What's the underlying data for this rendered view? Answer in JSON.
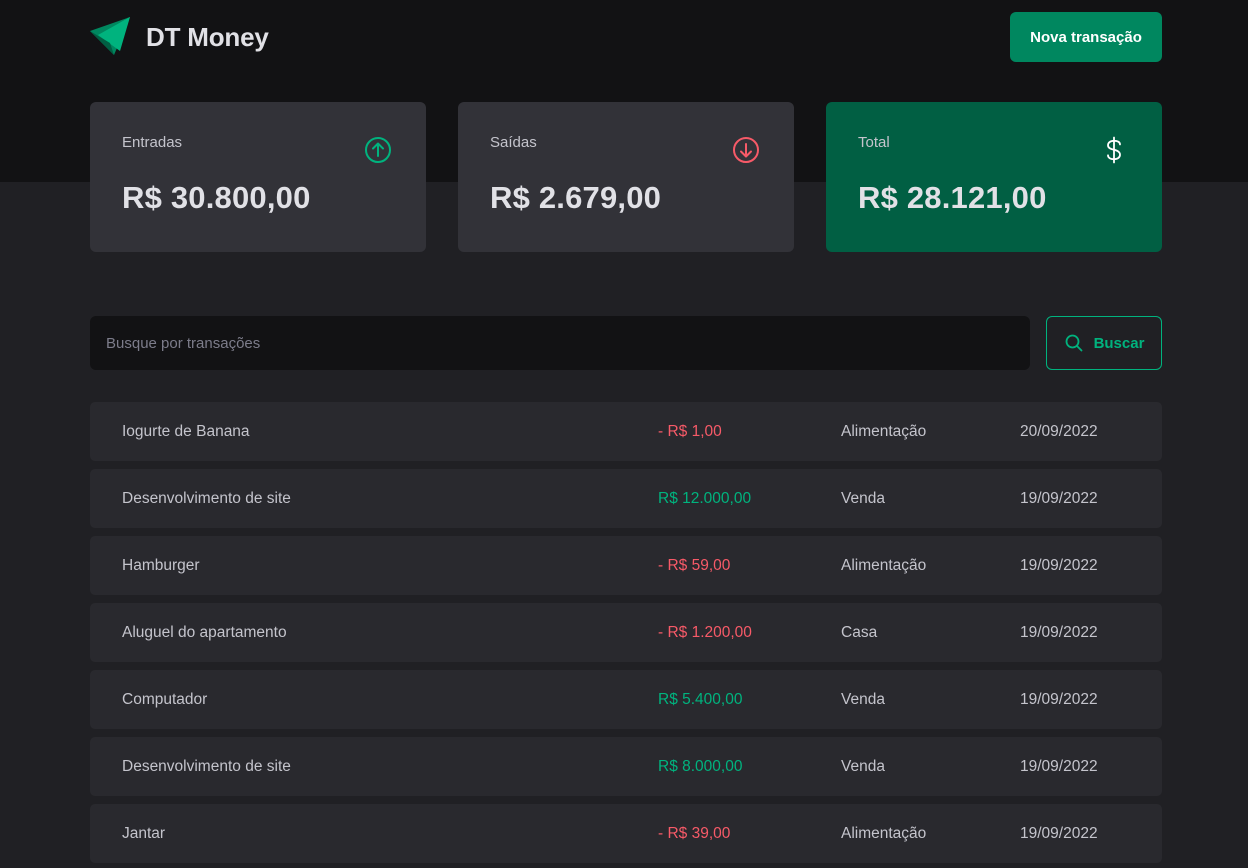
{
  "header": {
    "brand_name": "DT Money",
    "new_transaction_label": "Nova transação"
  },
  "summary": {
    "income": {
      "label": "Entradas",
      "value": "R$ 30.800,00",
      "icon": "arrow-circle-up-icon"
    },
    "outcome": {
      "label": "Saídas",
      "value": "R$ 2.679,00",
      "icon": "arrow-circle-down-icon"
    },
    "total": {
      "label": "Total",
      "value": "R$ 28.121,00",
      "icon": "currency-dollar-icon"
    }
  },
  "search": {
    "placeholder": "Busque por transações",
    "button_label": "Buscar"
  },
  "transactions": [
    {
      "description": "Iogurte de Banana",
      "price": "- R$ 1,00",
      "type": "outcome",
      "category": "Alimentação",
      "date": "20/09/2022"
    },
    {
      "description": "Desenvolvimento de site",
      "price": "R$ 12.000,00",
      "type": "income",
      "category": "Venda",
      "date": "19/09/2022"
    },
    {
      "description": "Hamburger",
      "price": "- R$ 59,00",
      "type": "outcome",
      "category": "Alimentação",
      "date": "19/09/2022"
    },
    {
      "description": "Aluguel do apartamento",
      "price": "- R$ 1.200,00",
      "type": "outcome",
      "category": "Casa",
      "date": "19/09/2022"
    },
    {
      "description": "Computador",
      "price": "R$ 5.400,00",
      "type": "income",
      "category": "Venda",
      "date": "19/09/2022"
    },
    {
      "description": "Desenvolvimento de site",
      "price": "R$ 8.000,00",
      "type": "income",
      "category": "Venda",
      "date": "19/09/2022"
    },
    {
      "description": "Jantar",
      "price": "- R$ 39,00",
      "type": "outcome",
      "category": "Alimentação",
      "date": "19/09/2022"
    }
  ],
  "colors": {
    "background": "#202024",
    "header_background": "#121214",
    "card": "#323238",
    "card_total": "#015f43",
    "row": "#29292e",
    "brand_green": "#00875f",
    "green_light": "#00b37e",
    "red": "#f75a68"
  }
}
